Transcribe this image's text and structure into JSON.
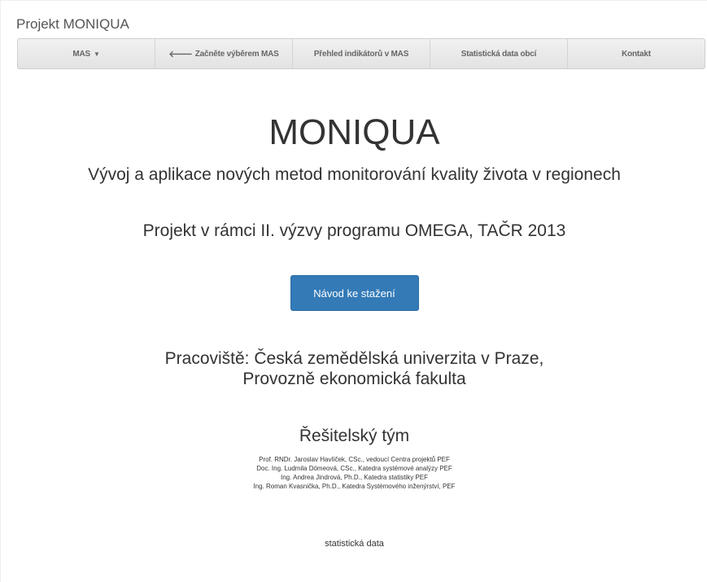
{
  "brand": "Projekt MONIQUA",
  "nav": {
    "items": [
      {
        "label": "MAS",
        "suffix_icon": "caret-down-icon"
      },
      {
        "label": "Začněte výběrem MAS",
        "prefix_icon": "arrow-left-icon"
      },
      {
        "label": "Přehled indikátorů v MAS"
      },
      {
        "label": "Statistická data obcí"
      },
      {
        "label": "Kontakt"
      }
    ]
  },
  "main": {
    "title": "MONIQUA",
    "subtitle": "Vývoj a aplikace nových metod monitorování kvality života v regionech",
    "program": "Projekt v rámci II. výzvy programu OMEGA, TAČR 2013",
    "download_button": "Návod ke stažení",
    "workplace_line1": "Pracoviště: Česká zemědělská univerzita v Praze,",
    "workplace_line2": "Provozně ekonomická fakulta",
    "team_title": "Řešitelský tým",
    "members": [
      "Prof. RNDr. Jaroslav Havlíček, CSc., vedoucí Centra projektů PEF",
      "Doc. Ing. Ludmila Dömeová, CSc., Katedra systémové analýzy PEF",
      "Ing. Andrea Jindrová, Ph.D., Katedra statistiky PEF",
      "Ing. Roman Kvasnička, Ph.D., Katedra Systémového inženýrství, PEF"
    ],
    "stats_link": "statistická data"
  },
  "colors": {
    "primary_button": "#337ab7",
    "navbar_bg": "#e8e8e8"
  }
}
